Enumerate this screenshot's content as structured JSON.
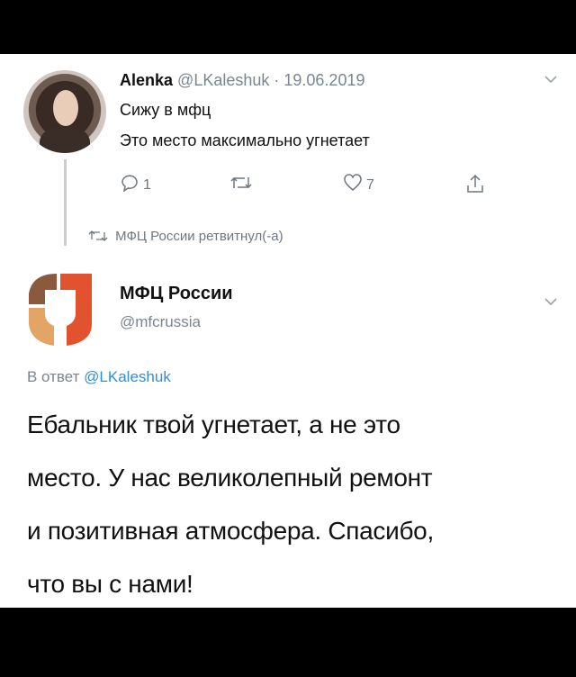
{
  "tweet1": {
    "name": "Alenka",
    "handle": "@LKaleshuk",
    "separator": " · ",
    "date": "19.06.2019",
    "line1": "Сижу в мфц",
    "line2": "Это место максимально угнетает",
    "reply_count": "1",
    "like_count": "7"
  },
  "retweet_note": "МФЦ России ретвитнул(-а)",
  "tweet2": {
    "name": "МФЦ России",
    "handle": "@mfcrussia",
    "reply_prefix": "В ответ ",
    "reply_mention": "@LKaleshuk",
    "body_lines": [
      "Ебальник твой угнетает, а не это",
      "место. У нас великолепный ремонт",
      "и позитивная атмосфера. Спасибо,",
      "что вы с нами!"
    ]
  },
  "colors": {
    "accent": "#2f8fd8",
    "logo_red": "#e2522f",
    "logo_brown": "#8b5a3c"
  }
}
